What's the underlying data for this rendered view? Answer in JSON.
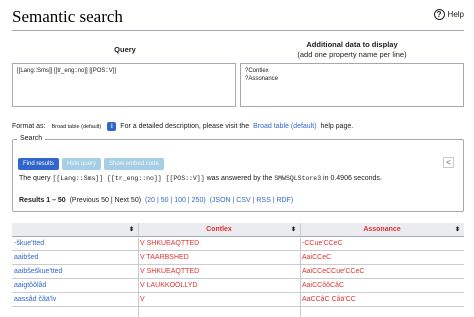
{
  "page": {
    "title": "Semantic search",
    "help": "Help"
  },
  "query": {
    "heading": "Query",
    "value": "[[Lang::Sms]] [[tr_eng::no]] [[POS::V]]"
  },
  "additional": {
    "heading": "Additional data to display",
    "subheading": "(add one property name per line)",
    "value": "?Contlex\n?Assonance"
  },
  "format": {
    "label": "Format as:",
    "selected": "Broad table (default)",
    "info_text": "For a detailed description, please visit the",
    "info_link": "Broad table (default)",
    "info_suffix": "help page."
  },
  "search": {
    "legend": "Search",
    "find_button": "Find results",
    "hide_button": "Hide query",
    "embed_button": "Show embed code",
    "collapse": "<",
    "query_prefix": "The query",
    "query_code": "[[Lang::Sms]] [[tr_eng::no]] [[POS::V]]",
    "query_middle": "was answered by the",
    "store": "SMWSQLStore3",
    "query_suffix": "in 0.4906 seconds."
  },
  "results": {
    "range": "Results 1 – 50",
    "nav": "(Previous 50 | Next 50)",
    "limits": "(20 | 50 | 100 | 250)",
    "exports": "(JSON | CSV | RSS | RDF)"
  },
  "table": {
    "headers": [
      "",
      "Contlex",
      "Assonance"
    ],
    "rows": [
      [
        "-škue'tted",
        "V SHKUEAQTTED",
        "-CCue'CCeC"
      ],
      [
        "aaibšed",
        "V TAARBSHED",
        "AaiCCeC"
      ],
      [
        "aaibšeškue'tted",
        "V SHKUEAQTTED",
        "AaiCCeCCue'CCeC"
      ],
      [
        "aaigtôôlâd",
        "V LAUKKOOLLYD",
        "AaiCCôôCâC"
      ],
      [
        "aassâd čâä'lv",
        "V",
        "AaCCâC Câä'CC"
      ]
    ]
  }
}
